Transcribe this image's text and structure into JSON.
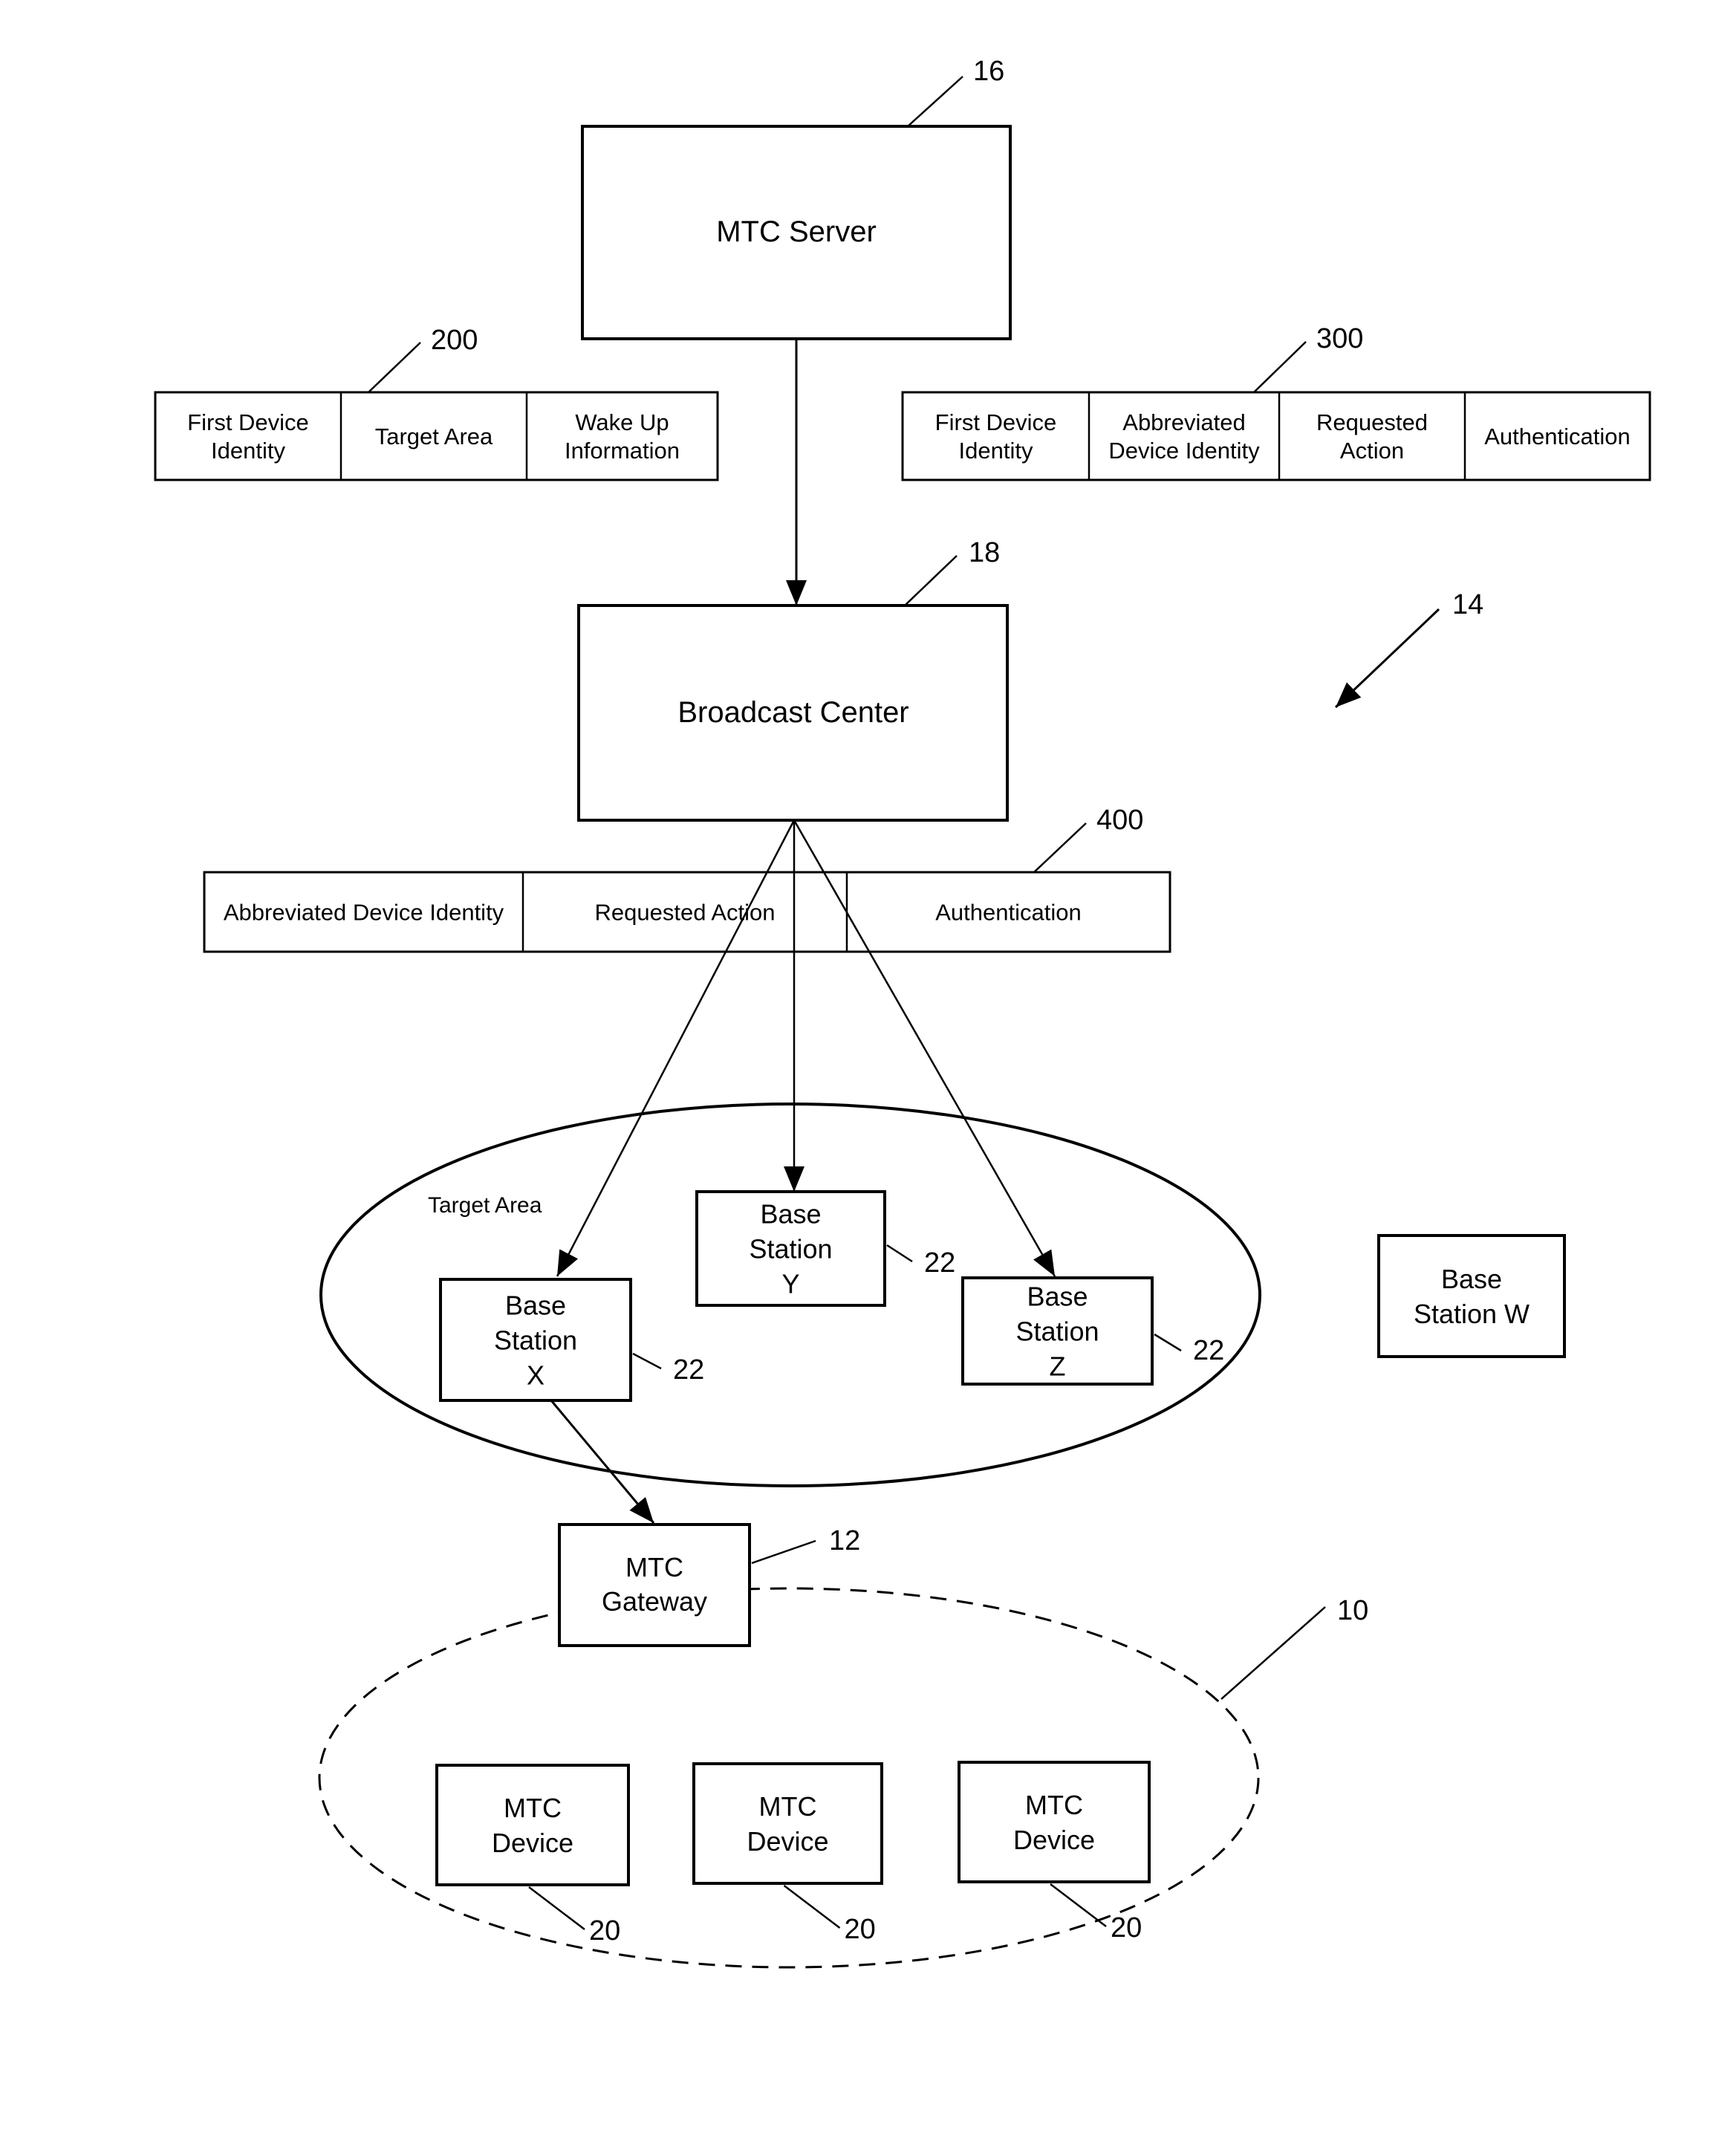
{
  "figure": {
    "mtc_server": {
      "label": "MTC Server",
      "ref": "16"
    },
    "broadcast_center": {
      "label": "Broadcast Center",
      "ref": "18"
    },
    "system_ref": "14",
    "message_200": {
      "ref": "200",
      "fields": [
        "First Device|Identity",
        "Target Area",
        "Wake Up|Information"
      ]
    },
    "message_300": {
      "ref": "300",
      "fields": [
        "First Device|Identity",
        "Abbreviated|Device Identity",
        "Requested|Action",
        "Authentication"
      ]
    },
    "message_400": {
      "ref": "400",
      "fields": [
        "Abbreviated Device Identity",
        "Requested Action",
        "Authentication"
      ]
    },
    "target_area": {
      "label": "Target Area"
    },
    "base_stations": [
      {
        "name": "X",
        "lines": [
          "Base",
          "Station",
          "X"
        ],
        "ref": "22"
      },
      {
        "name": "Y",
        "lines": [
          "Base",
          "Station",
          "Y"
        ],
        "ref": "22"
      },
      {
        "name": "Z",
        "lines": [
          "Base",
          "Station",
          "Z"
        ],
        "ref": "22"
      },
      {
        "name": "W",
        "lines": [
          "Base",
          "Station W"
        ],
        "ref": ""
      }
    ],
    "mtc_gateway": {
      "lines": [
        "MTC",
        "Gateway"
      ],
      "ref": "12"
    },
    "device_group_ref": "10",
    "mtc_devices": [
      {
        "lines": [
          "MTC",
          "Device"
        ],
        "ref": "20"
      },
      {
        "lines": [
          "MTC",
          "Device"
        ],
        "ref": "20"
      },
      {
        "lines": [
          "MTC",
          "Device"
        ],
        "ref": "20"
      }
    ]
  }
}
